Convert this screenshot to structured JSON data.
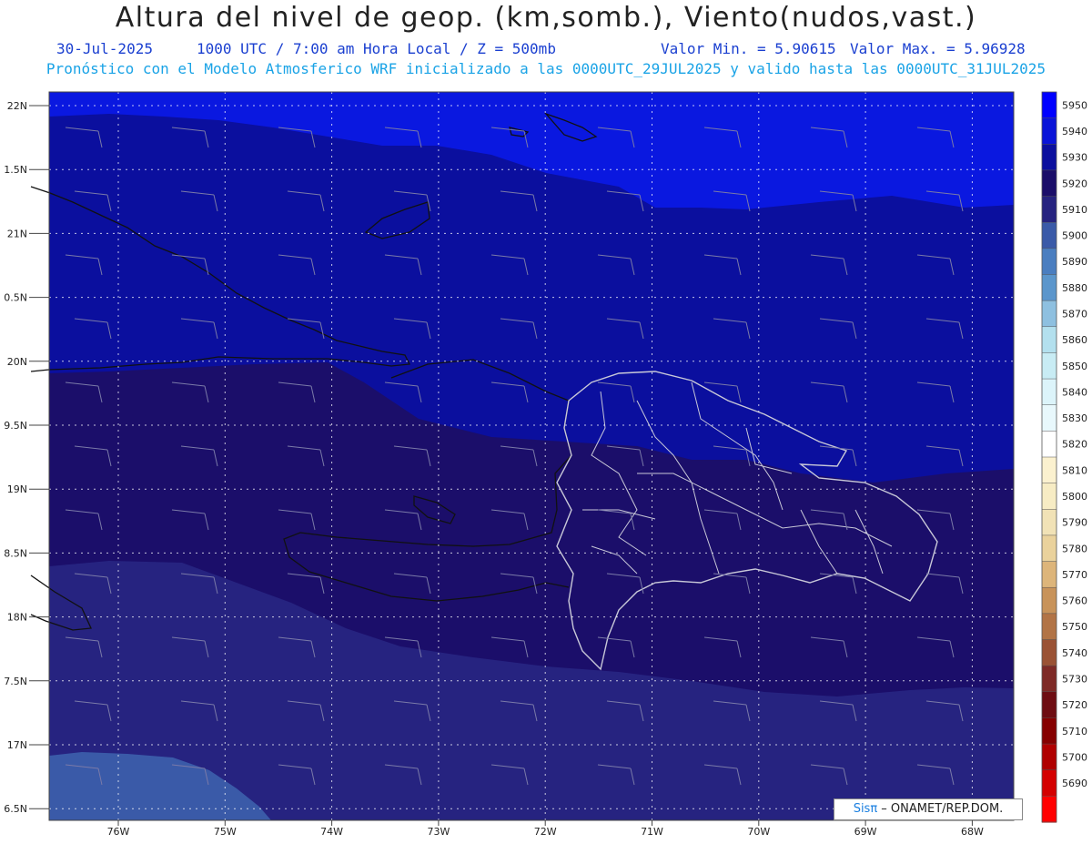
{
  "header": {
    "title": "Altura del nivel de geop. (km,somb.), Viento(nudos,vast.)",
    "date": "30-Jul-2025",
    "time": "1000 UTC / 7:00 am Hora Local / Z = 500mb",
    "vmin": "Valor Min. = 5.90615",
    "vmax": "Valor Max. = 5.96928",
    "model_line": "Pronóstico con el Modelo Atmosferico WRF inicializado a las 0000UTC_29JUL2025 y valido hasta las  0000UTC_31JUL2025"
  },
  "axes": {
    "lat_labels": [
      "22N",
      "1.5N",
      "21N",
      "0.5N",
      "20N",
      "9.5N",
      "19N",
      "8.5N",
      "18N",
      "7.5N",
      "17N",
      "6.5N"
    ],
    "lon_labels": [
      "76W",
      "75W",
      "74W",
      "73W",
      "72W",
      "71W",
      "70W",
      "69W",
      "68W"
    ]
  },
  "colorbar": {
    "levels": [
      "5950",
      "5940",
      "5930",
      "5920",
      "5910",
      "5900",
      "5890",
      "5880",
      "5870",
      "5860",
      "5850",
      "5840",
      "5830",
      "5820",
      "5810",
      "5800",
      "5790",
      "5780",
      "5770",
      "5760",
      "5750",
      "5740",
      "5730",
      "5720",
      "5710",
      "5700",
      "5690"
    ],
    "colors": [
      "#0000ff",
      "#0a14d8",
      "#0b0f9e",
      "#1b0e6a",
      "#262380",
      "#3a5aa8",
      "#4a7ec0",
      "#5b96cc",
      "#8ec0e0",
      "#b3e0ee",
      "#c8ecf4",
      "#dcf4fa",
      "#e8f8fc",
      "#ffffff",
      "#fbf1cf",
      "#f7ecc4",
      "#f1e2b6",
      "#ead29c",
      "#ddb57a",
      "#c8935a",
      "#b27446",
      "#9a5234",
      "#7e2a26",
      "#6e0d12",
      "#860000",
      "#b00000",
      "#d40000",
      "#ff0000"
    ]
  },
  "credit": {
    "brand": "Sisπ",
    "org": " – ONAMET/REP.DOM."
  },
  "map_colors": {
    "band_north": "#0a18e0",
    "band_mid": "#0b0f9e",
    "band_south": "#1b0e6a",
    "band_south2": "#262380",
    "band_sw": "#3a5aa8"
  }
}
